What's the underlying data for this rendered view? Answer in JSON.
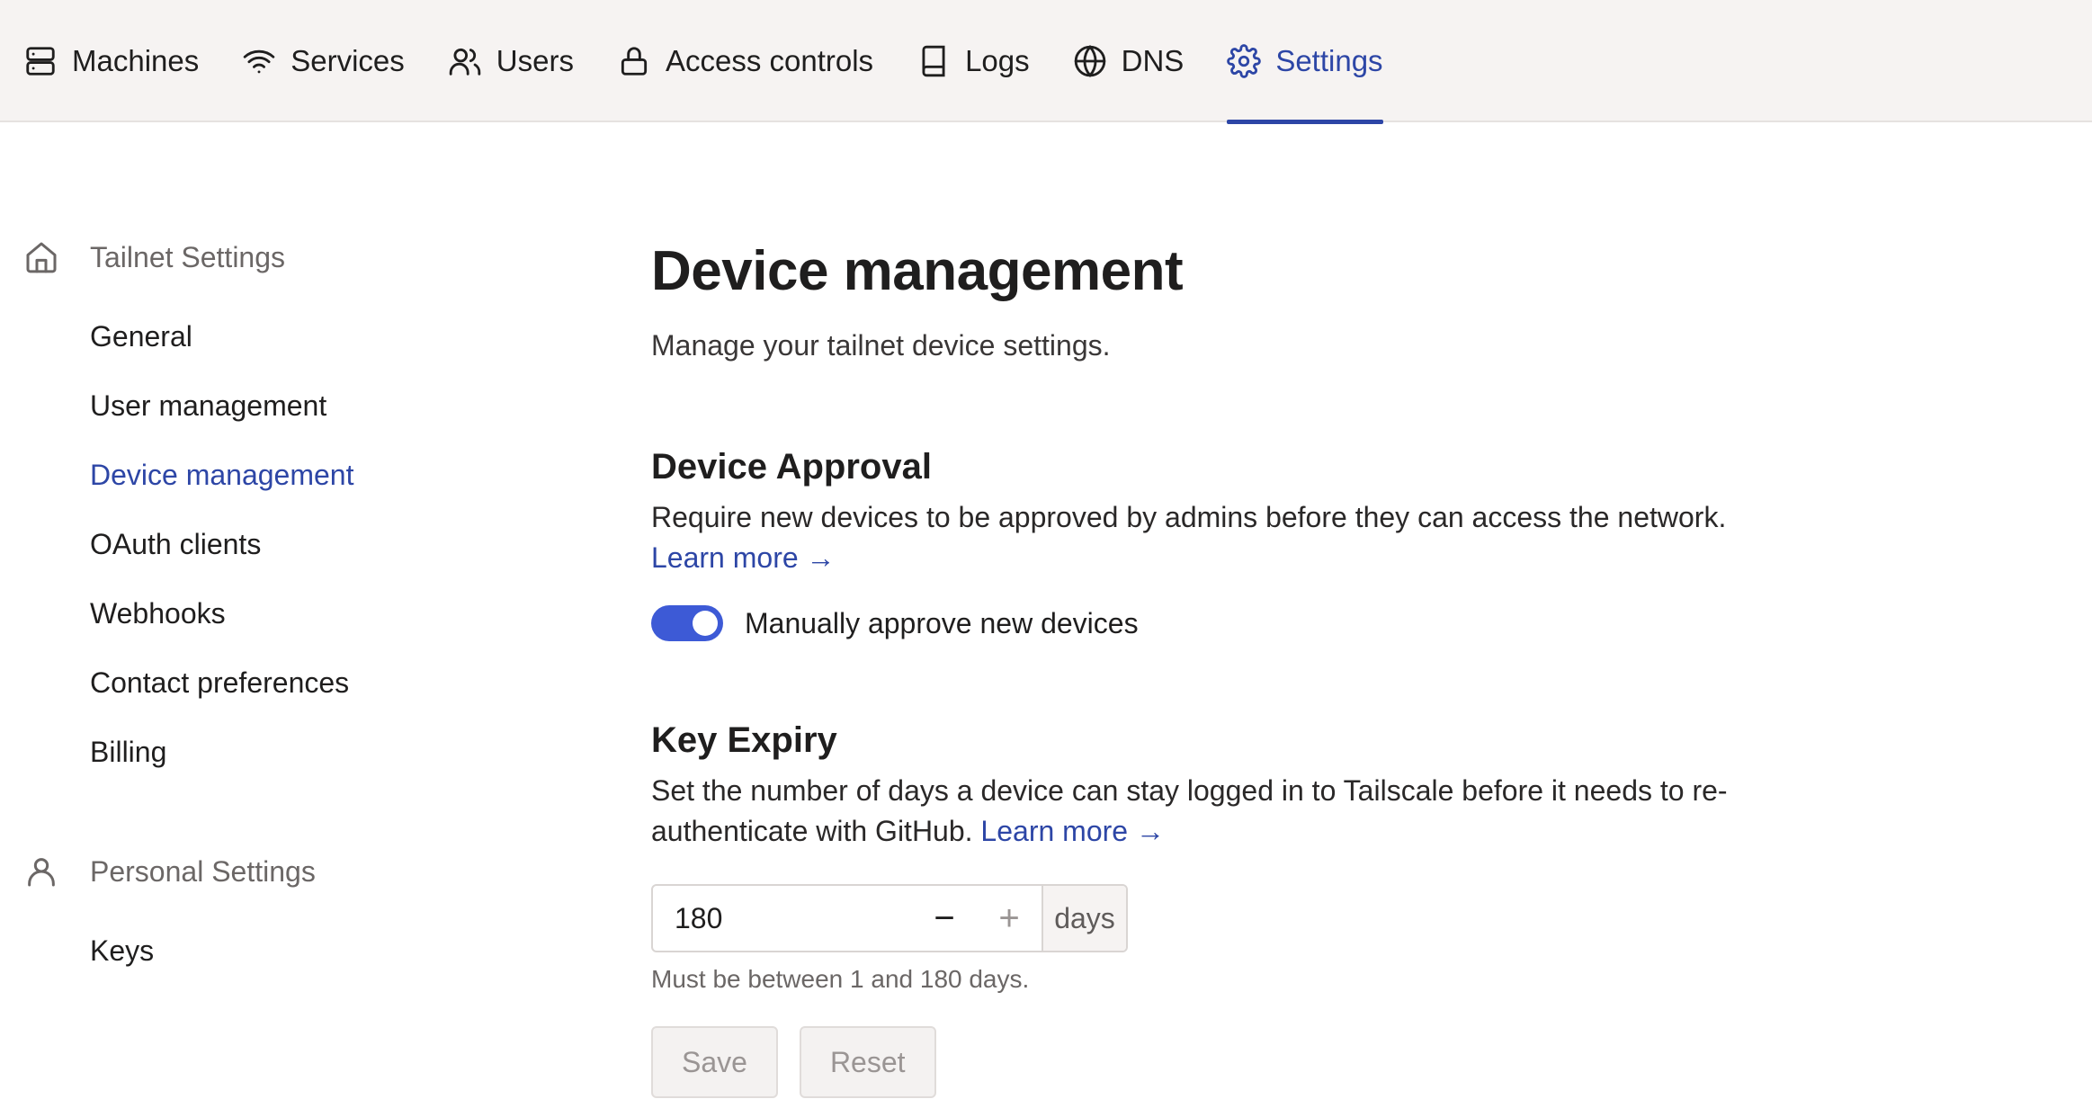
{
  "nav": {
    "items": [
      {
        "label": "Machines",
        "icon": "server-icon"
      },
      {
        "label": "Services",
        "icon": "wifi-icon"
      },
      {
        "label": "Users",
        "icon": "users-icon"
      },
      {
        "label": "Access controls",
        "icon": "lock-icon"
      },
      {
        "label": "Logs",
        "icon": "book-icon"
      },
      {
        "label": "DNS",
        "icon": "globe-icon"
      },
      {
        "label": "Settings",
        "icon": "gear-icon",
        "active": true
      }
    ]
  },
  "sidebar": {
    "tailnet": {
      "title": "Tailnet Settings",
      "icon": "home-icon",
      "items": [
        "General",
        "User management",
        "Device management",
        "OAuth clients",
        "Webhooks",
        "Contact preferences",
        "Billing"
      ],
      "active": "Device management"
    },
    "personal": {
      "title": "Personal Settings",
      "icon": "person-icon",
      "items": [
        "Keys"
      ]
    }
  },
  "main": {
    "title": "Device management",
    "subtitle": "Manage your tailnet device settings.",
    "approval": {
      "heading": "Device Approval",
      "description": "Require new devices to be approved by admins before they can access the network.",
      "learn_more": "Learn more →",
      "toggle_label": "Manually approve new devices",
      "toggle_on": true
    },
    "key_expiry": {
      "heading": "Key Expiry",
      "description": "Set the number of days a device can stay logged in to Tailscale before it needs to re-authenticate with GitHub.",
      "learn_more": "Learn more →",
      "value": "180",
      "decrement": "−",
      "increment": "+",
      "unit": "days",
      "hint": "Must be between 1 and 180 days.",
      "save_label": "Save",
      "reset_label": "Reset"
    }
  },
  "colors": {
    "accent": "#2d46a6",
    "toggle": "#3d5ad6",
    "topbar_bg": "#f6f3f2"
  }
}
